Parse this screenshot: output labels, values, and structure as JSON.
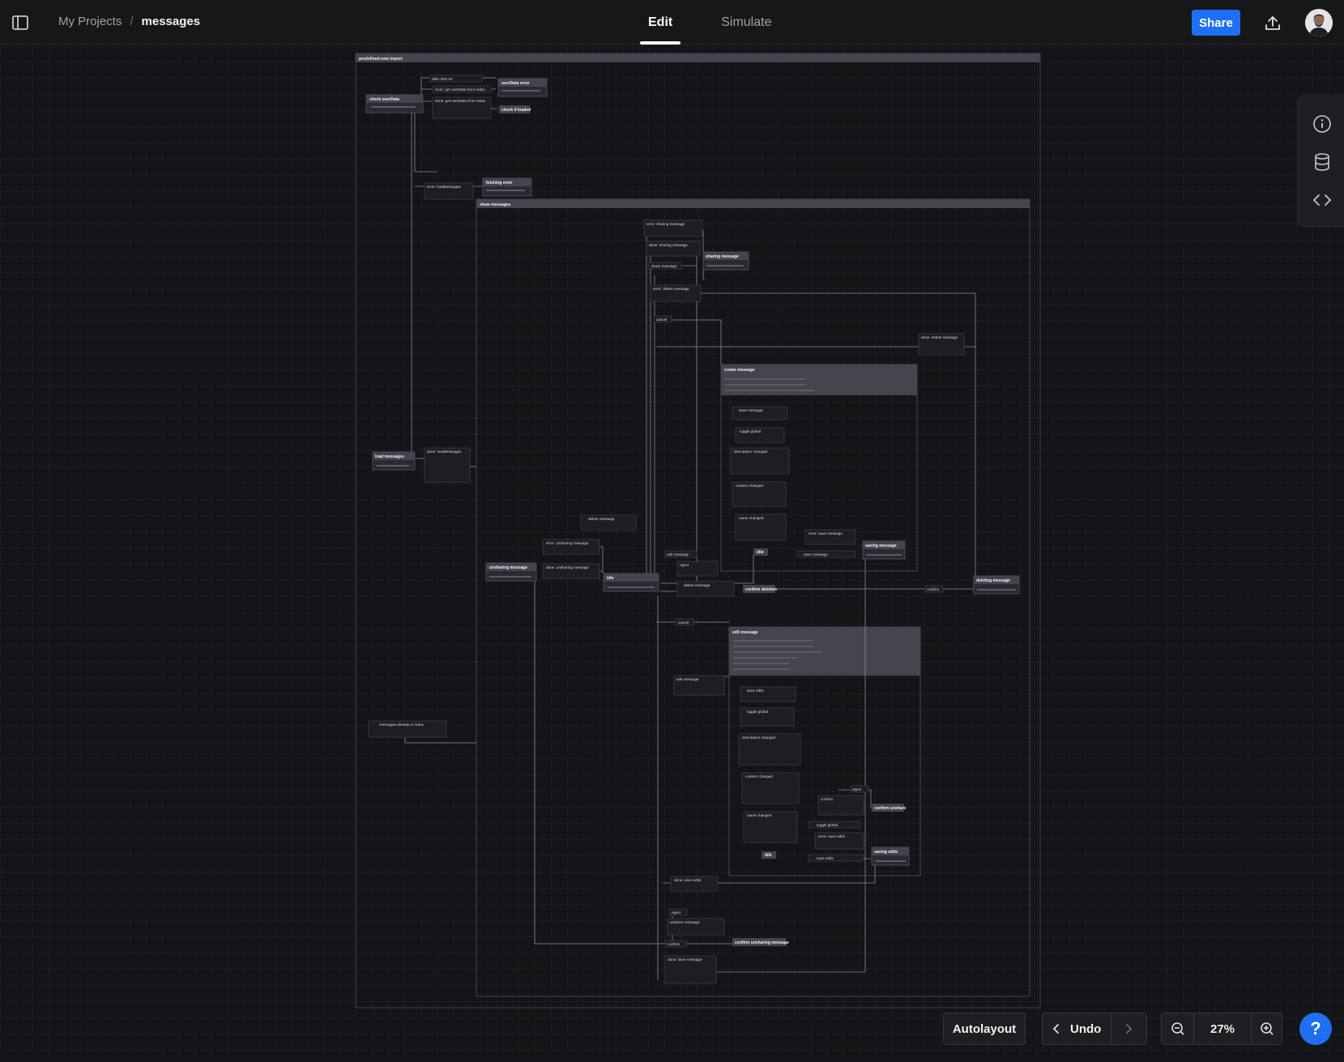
{
  "breadcrumb": {
    "project": "My Projects",
    "separator": "/",
    "current": "messages"
  },
  "tabs": [
    {
      "label": "Edit",
      "active": true
    },
    {
      "label": "Simulate",
      "active": false
    }
  ],
  "header": {
    "share_label": "Share"
  },
  "toolbar": {
    "autolayout_label": "Autolayout",
    "undo_label": "Undo",
    "zoom_level": "27%",
    "help_label": "?"
  },
  "icons": {
    "sidebar": "sidebar-toggle-icon",
    "upload": "upload-icon",
    "info": "info-icon",
    "database": "database-icon",
    "code": "code-icon",
    "zoom_out": "zoom-out-icon",
    "zoom_in": "zoom-in-icon",
    "undo": "chevron-left-icon",
    "redo": "chevron-right-icon"
  },
  "colors": {
    "accent": "#1f6ff2",
    "background": "#141518",
    "state_header": "#43434c",
    "state_body": "#2a2b30"
  },
  "diagram": {
    "root_title": "predefined-new import",
    "states": {
      "check_userdata": "check userData",
      "userdata_error": "userData error",
      "check_loaded": "check if loaded",
      "fetching_error": "fetching error",
      "load_messages": "load messages",
      "show_messages": "show messages",
      "sharing_message": "sharing message",
      "create_message": "create message",
      "idle": "idle",
      "saving_message": "saving message",
      "unsharing_message": "unsharing message",
      "deleting_message": "deleting message",
      "confirm_deletion": "confirm deletion",
      "edit_message": "edit message",
      "confirm_unshare": "confirm unshare",
      "saving_edits": "saving edits",
      "confirm_unsharing_message": "confirm unsharing message"
    },
    "events": {
      "after_300": "after 300 ms",
      "error_get_userdata": "error: get userData from redux",
      "done_get_userdata": "done: get userData from redux",
      "error_load_messages": "error: loadMessages",
      "done_load_messages": "done: loadMessages",
      "error_sharing": "error: sharing message",
      "done_sharing": "done: sharing message",
      "share_message": "share message",
      "error_delete": "error: delete message",
      "cancel": "cancel",
      "done_delete": "done: delete message",
      "save_message": "save message",
      "toggle_global": "toggle global",
      "description_changed": "description changed",
      "content_changed": "content changed",
      "name_changed": "name changed",
      "error_save_message": "error: save message",
      "delete_message": "delete message",
      "error_unsharing": "error: unsharing message",
      "done_unsharing": "done: unsharing message",
      "edit_message": "edit message",
      "reject": "reject",
      "confirm": "confirm",
      "save_edits": "save edits",
      "error_save_edits": "error: save edits",
      "done_save_edits": "done: save edits",
      "unshare_message": "unshare message",
      "done_save_message": "done: save message",
      "messages_in_redux": "messages already in redux"
    }
  }
}
